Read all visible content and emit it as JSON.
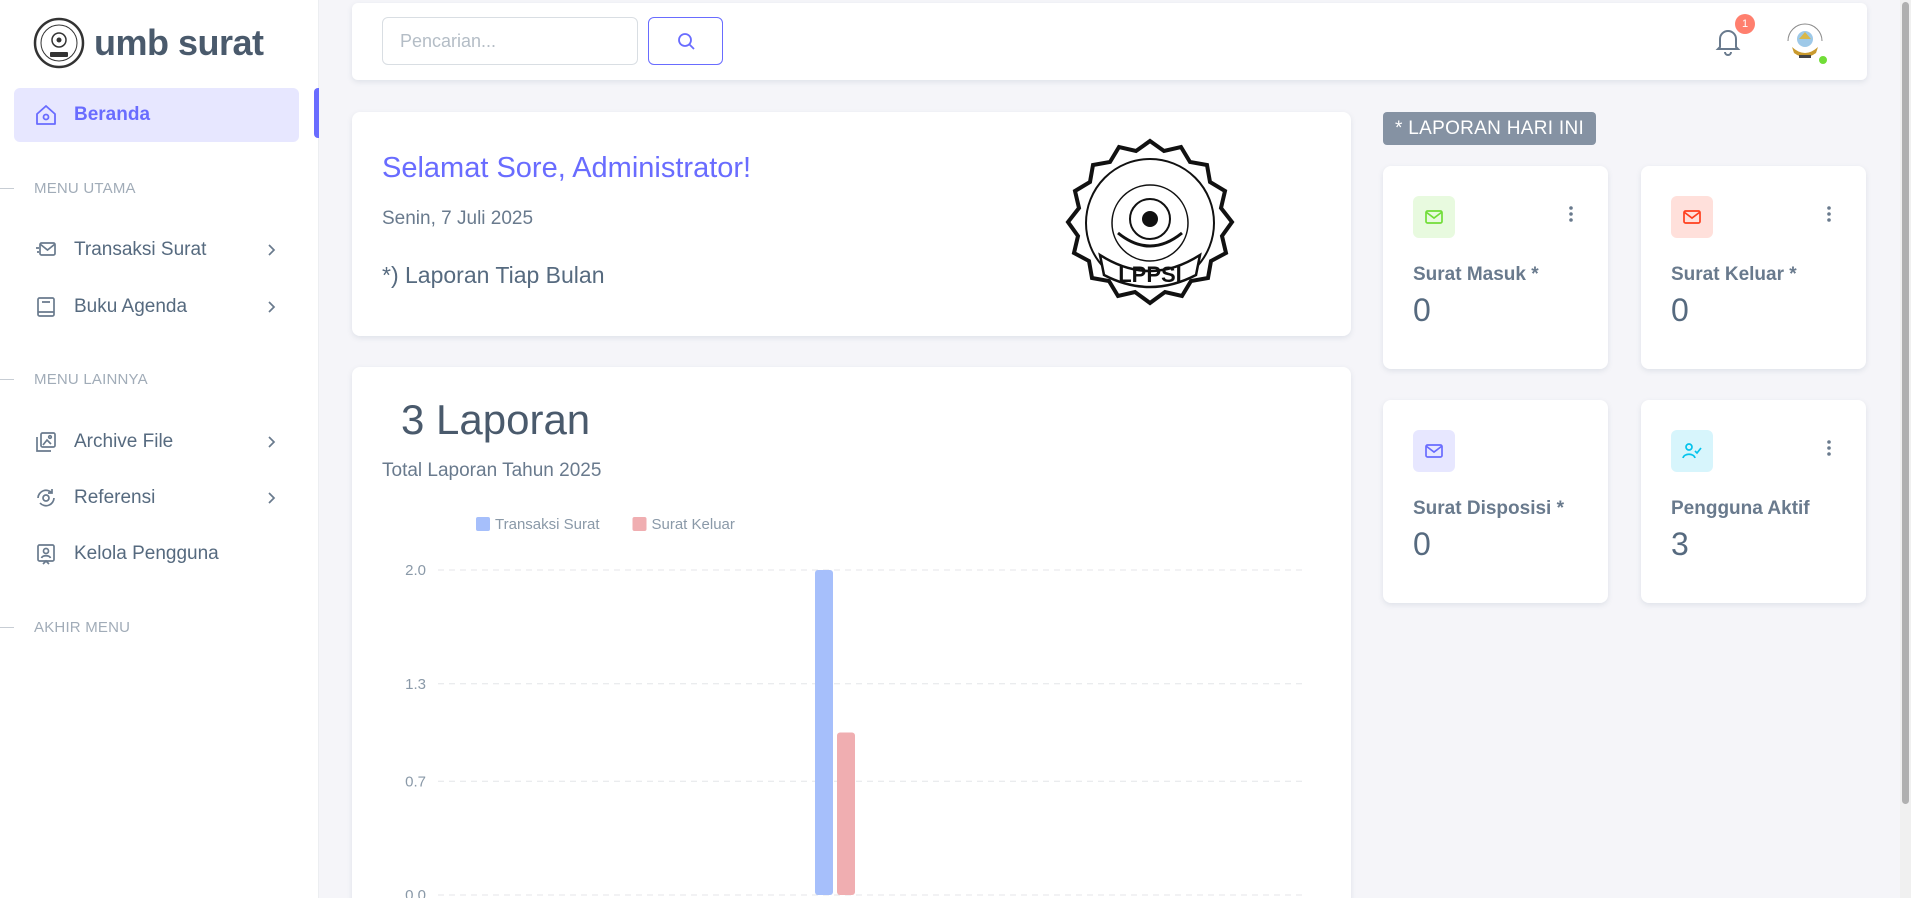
{
  "brand": {
    "name": "umb surat"
  },
  "sidebar": {
    "items": [
      {
        "label": "Beranda",
        "active": true
      },
      {
        "label": "Transaksi Surat"
      },
      {
        "label": "Buku Agenda"
      },
      {
        "label": "Archive File"
      },
      {
        "label": "Referensi"
      },
      {
        "label": "Kelola Pengguna"
      }
    ],
    "headers": [
      "MENU UTAMA",
      "MENU LAINNYA",
      "AKHIR MENU"
    ]
  },
  "navbar": {
    "search_placeholder": "Pencarian...",
    "notification_count": "1"
  },
  "welcome": {
    "title": "Selamat Sore, Administrator!",
    "date": "Senin, 7 Juli 2025",
    "note": "*) Laporan Tiap Bulan",
    "logo_text": "LPPSI"
  },
  "chart_summary": {
    "total": "3 Laporan",
    "subtitle": "Total Laporan Tahun 2025"
  },
  "chart_data": {
    "type": "bar",
    "categories": [
      ""
    ],
    "series": [
      {
        "name": "Transaksi Surat",
        "values": [
          2
        ],
        "color": "#a6bffb"
      },
      {
        "name": "Surat Keluar",
        "values": [
          1
        ],
        "color": "#f0aeb1"
      }
    ],
    "yticks": [
      "2.0",
      "1.3",
      "0.7",
      "0.0"
    ],
    "ylim": [
      0,
      2
    ],
    "legend": "top-left",
    "grid": true
  },
  "today": {
    "tag": "* LAPORAN HARI INI",
    "stats": [
      {
        "label": "Surat Masuk *",
        "value": "0",
        "color": "#71dd37",
        "bg": "#e8fadf",
        "icon": "mail-icon"
      },
      {
        "label": "Surat Keluar *",
        "value": "0",
        "color": "#ff3e1d",
        "bg": "#ffe0db",
        "icon": "mail-icon"
      },
      {
        "label": "Surat Disposisi *",
        "value": "0",
        "color": "#696cff",
        "bg": "#e7e7ff",
        "icon": "mail-icon"
      },
      {
        "label": "Pengguna Aktif",
        "value": "3",
        "color": "#03c3ec",
        "bg": "#d7f5fc",
        "icon": "user-check-icon"
      }
    ]
  }
}
